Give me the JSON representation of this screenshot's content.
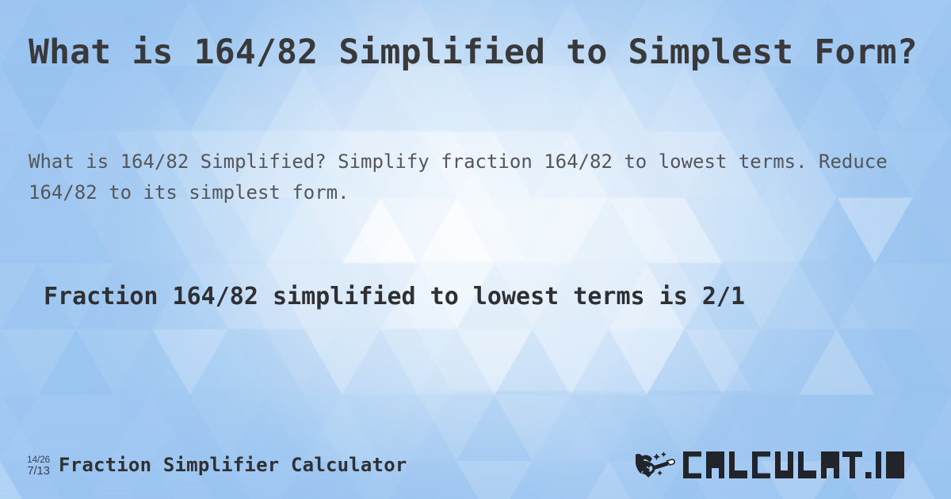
{
  "page": {
    "title": "What is 164/82 Simplified to Simplest Form?",
    "subtitle": "What is 164/82 Simplified? Simplify fraction 164/82 to lowest terms. Reduce 164/82 to its simplest form.",
    "result": "Fraction 164/82 simplified to lowest terms is 2/1"
  },
  "fraction": {
    "numerator": "164",
    "denominator": "82",
    "expression": "164/82",
    "simplified": "2/1",
    "simplified_numerator": "2",
    "simplified_denominator": "1"
  },
  "footer": {
    "tool_name": "Fraction Simplifier Calculator",
    "icon": {
      "name": "fraction-simplify-icon",
      "original": "14/26",
      "reduced": "7/13"
    },
    "logo": {
      "wordmark": "CALCULAT.IO",
      "mark_name": "hand-holding-magic-wand-icon"
    }
  },
  "colors": {
    "background_blue": "#a9cdf2",
    "background_light": "#eaf3fd",
    "title_text": "#39393b",
    "subtitle_text": "#55565a",
    "result_text": "#2f3033",
    "footer_text": "#2f3033",
    "icon_text": "#3d4450",
    "logo_dark": "#22242b"
  }
}
